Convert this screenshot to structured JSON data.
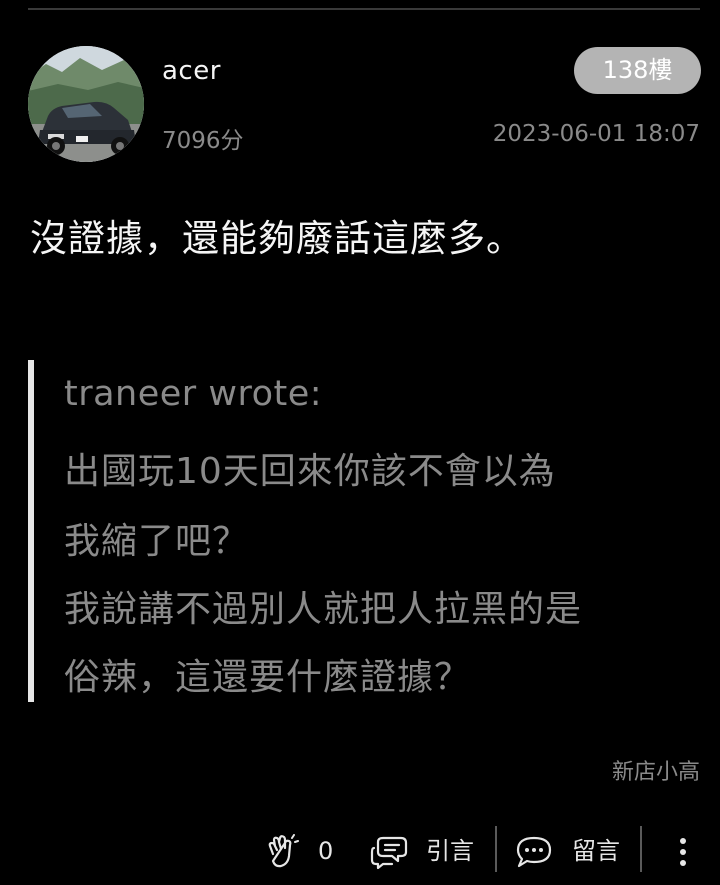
{
  "post": {
    "username": "acer",
    "score": "7096分",
    "floor": "138樓",
    "timestamp": "2023-06-01 18:07",
    "content": "沒證據，還能夠廢話這麼多。",
    "quote": {
      "author": "traneer wrote:",
      "lines": [
        "出國玩10天回來你該不會以為",
        "我縮了吧？",
        "我說講不過別人就把人拉黑的是",
        "俗辣，這還要什麼證據？"
      ]
    },
    "signature": "新店小高"
  },
  "actions": {
    "like_count": "0",
    "quote_label": "引言",
    "comment_label": "留言"
  },
  "icons": {
    "like": "clap-hands-icon",
    "quote": "quote-bubbles-icon",
    "comment": "comment-bubble-icon",
    "more": "more-vertical-icon"
  },
  "colors": {
    "background": "#000000",
    "text_primary": "#f5f5f5",
    "text_secondary": "#8a8a8a",
    "badge_background": "#b4b4b4"
  }
}
